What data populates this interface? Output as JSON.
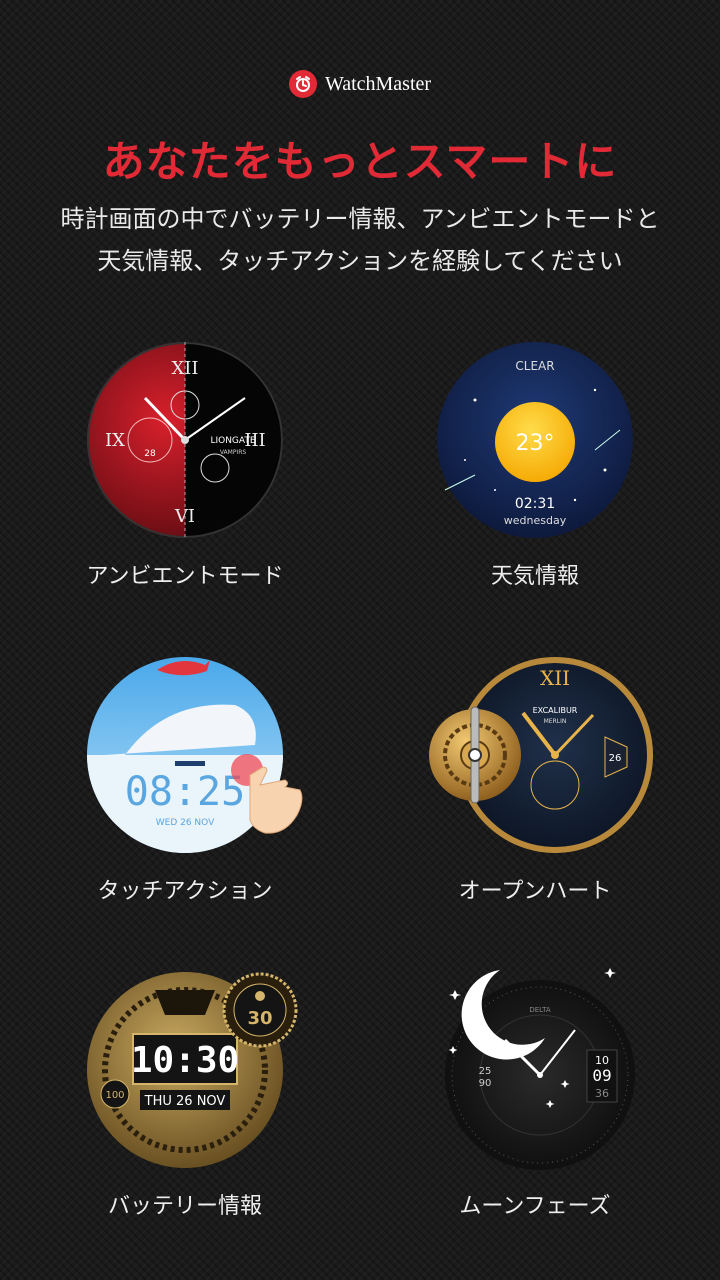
{
  "brand": {
    "name": "WatchMaster"
  },
  "headline": "あなたをもっとスマートに",
  "subtitle": {
    "line1": "時計画面の中でバッテリー情報、アンビエントモードと",
    "line2": "天気情報、タッチアクションを経験してください"
  },
  "features": [
    {
      "label": "アンビエントモード",
      "face": {
        "brand": "LIONGATE",
        "sub": "VAMPIRS",
        "date": "28"
      }
    },
    {
      "label": "天気情報",
      "face": {
        "condition": "CLEAR",
        "temp": "23°",
        "time": "02:31",
        "day": "wednesday"
      }
    },
    {
      "label": "タッチアクション",
      "face": {
        "time": "08:25",
        "date": "WED 26 NOV"
      }
    },
    {
      "label": "オープンハート",
      "face": {
        "brand": "EXCALIBUR",
        "sub": "MERLIN",
        "date": "26",
        "numeral": "XII"
      }
    },
    {
      "label": "バッテリー情報",
      "face": {
        "time": "10:30",
        "date": "THU 26 NOV",
        "battery": "30",
        "steps": "100"
      }
    },
    {
      "label": "ムーンフェーズ",
      "face": {
        "brand": "DELTA",
        "hour": "10",
        "minute": "09",
        "second": "36",
        "left": "90",
        "left2": "25"
      }
    }
  ],
  "colors": {
    "accent": "#e12a36",
    "background": "#1b1b1b"
  }
}
